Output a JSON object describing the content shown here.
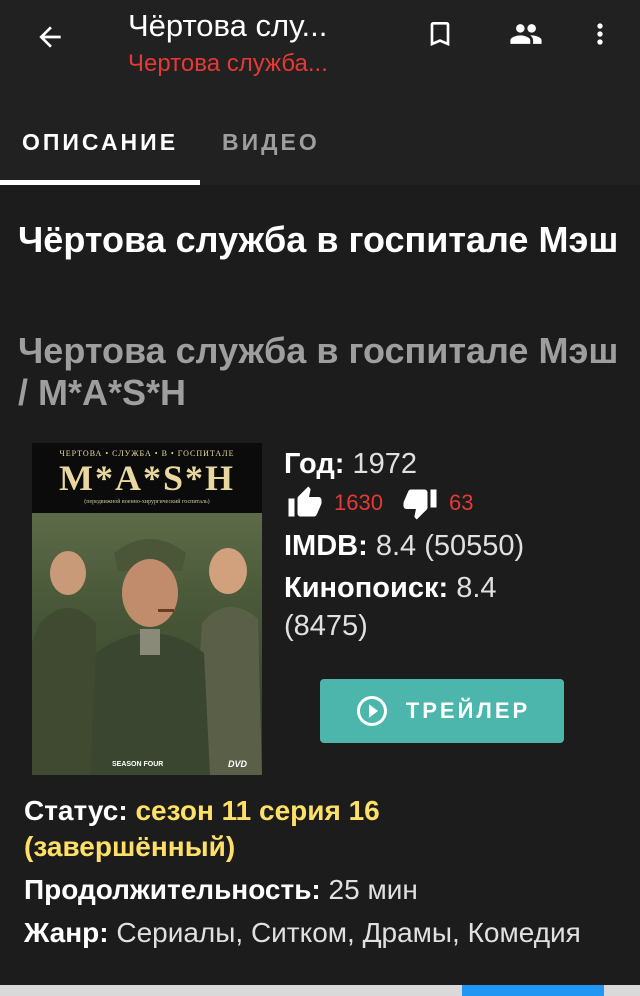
{
  "header": {
    "title": "Чёртова слу...",
    "subtitle": "Чертова служба...",
    "back_icon": "arrow-left-icon",
    "bookmark_icon": "bookmark-outline-icon",
    "people_icon": "people-icon",
    "more_icon": "more-vert-icon"
  },
  "tabs": [
    {
      "label": "ОПИСАНИЕ",
      "active": true
    },
    {
      "label": "ВИДЕО",
      "active": false
    }
  ],
  "movie": {
    "title": "Чёртова служба в госпитале Мэш",
    "original_title": "Чертова служба в госпитале Мэш / M*A*S*H",
    "poster": {
      "line1": "ЧЕРТОВА • СЛУЖБА • В • ГОСПИТАЛЕ",
      "logo": "M*A*S*H",
      "line2": "(передвижной военно-хирургический госпиталь)",
      "season": "SEASON FOUR",
      "dvd": "DVD"
    },
    "year_label": "Год:",
    "year": "1972",
    "likes": "1630",
    "dislikes": "63",
    "imdb_label": "IMDB:",
    "imdb": "8.4 (50550)",
    "kp_label": "Кинопоиск:",
    "kp_value": "8.4",
    "kp_votes": "(8475)",
    "trailer_label": "ТРЕЙЛЕР",
    "status_label": "Статус:",
    "status_value": "сезон 11 серия 16",
    "status_state": "(завершённый)",
    "duration_label": "Продолжительность:",
    "duration_value": "25 мин",
    "genre_label": "Жанр:",
    "genre_value": "Сериалы, Ситком, Драмы, Комедия"
  },
  "colors": {
    "background": "#1c1c1c",
    "appbar": "#212121",
    "accent_red": "#e53935",
    "trailer_teal": "#4db6ac",
    "status_yellow": "#ffe066"
  }
}
